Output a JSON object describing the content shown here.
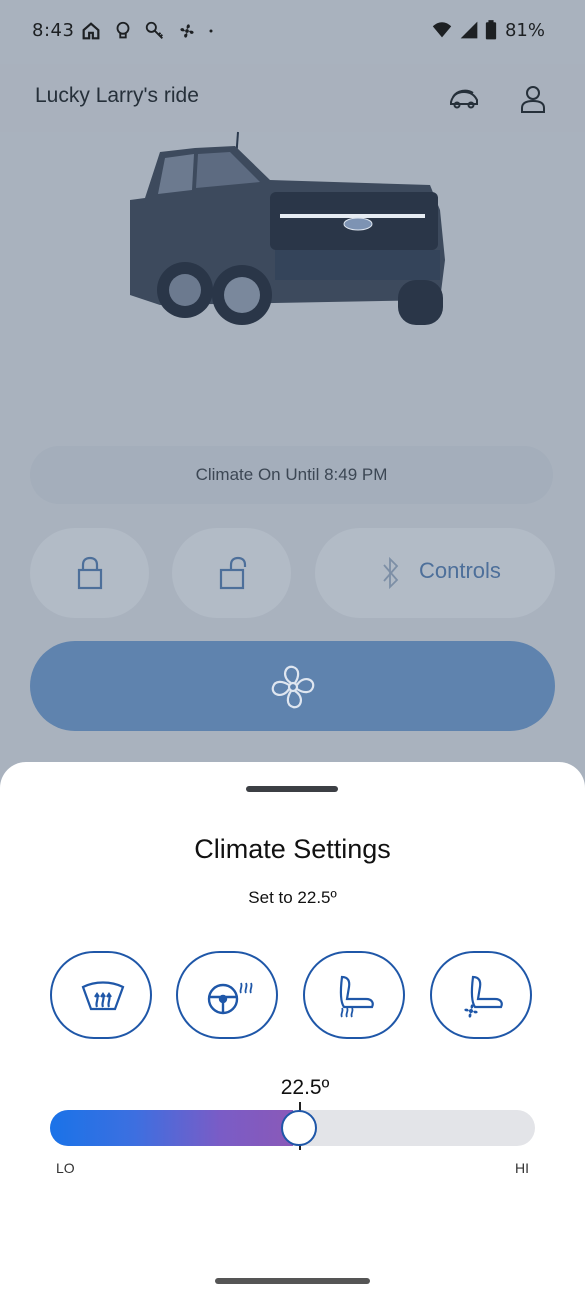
{
  "status_bar": {
    "time": "8:43",
    "battery": "81%",
    "left_icons": [
      "home-icon",
      "bulb-icon",
      "key-icon",
      "fan-icon",
      "dot-icon"
    ],
    "right_icons": [
      "wifi-icon",
      "signal-icon",
      "battery-icon"
    ]
  },
  "header": {
    "title": "Lucky Larry's ride",
    "icons": [
      "vehicle-switch-icon",
      "account-icon"
    ]
  },
  "vehicle": {
    "status_text": "Climate On Until 8:49 PM"
  },
  "controls": {
    "lock_icon": "lock-icon",
    "unlock_icon": "unlock-icon",
    "controls_label": "Controls",
    "bluetooth_icon": "bluetooth-icon",
    "fan_icon": "fan-icon"
  },
  "sheet": {
    "title": "Climate Settings",
    "subtitle": "Set to 22.5º",
    "features": [
      "defrost-icon",
      "heated-steering-wheel-icon",
      "heated-seat-icon",
      "ventilated-seat-icon"
    ],
    "temperature": "22.5º",
    "slider_position": 0.5,
    "slider_min_label": "LO",
    "slider_max_label": "HI"
  },
  "colors": {
    "accent": "#1f57a8",
    "fan_button": "#5f83ae",
    "gradient_start": "#1a73e8",
    "gradient_end": "#8a59b8"
  }
}
